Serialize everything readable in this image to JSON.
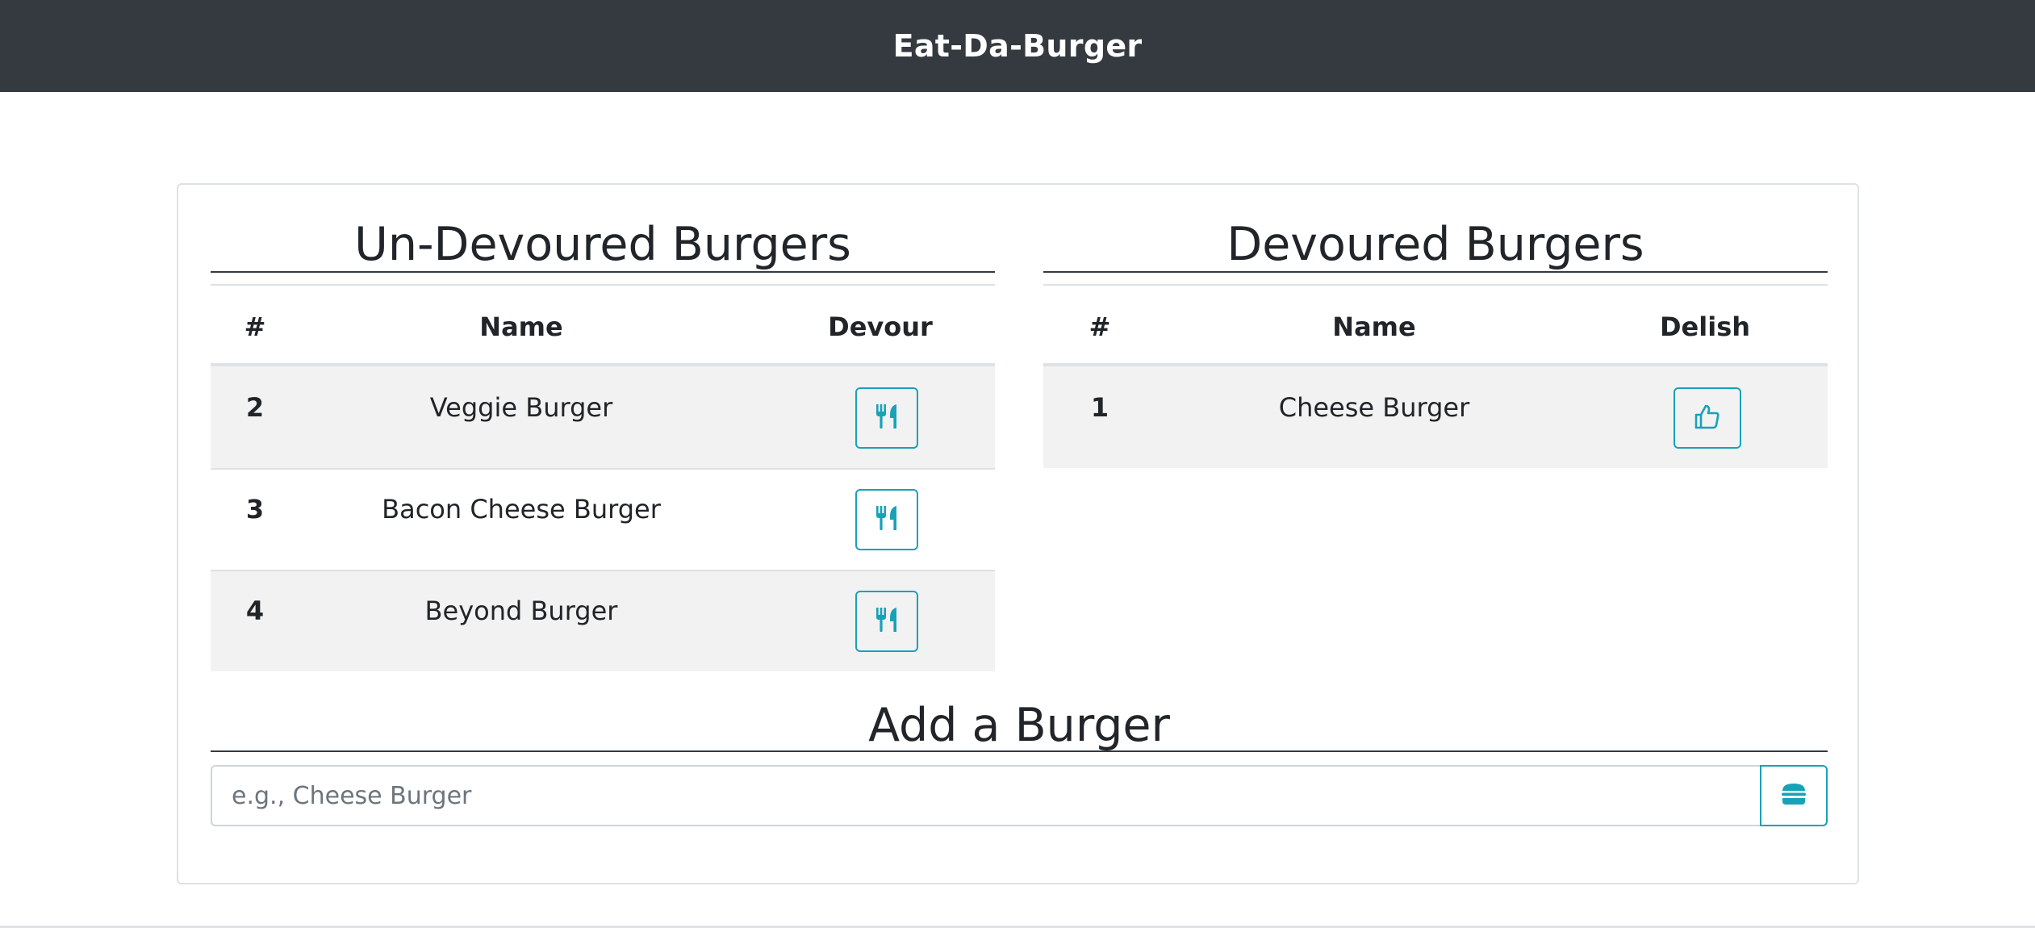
{
  "navbar": {
    "brand": "Eat-Da-Burger"
  },
  "undevoured": {
    "title": "Un-Devoured Burgers",
    "headers": {
      "num": "#",
      "name": "Name",
      "action": "Devour"
    },
    "rows": [
      {
        "id": "2",
        "name": "Veggie Burger",
        "action_icon": "utensils-icon"
      },
      {
        "id": "3",
        "name": "Bacon Cheese Burger",
        "action_icon": "utensils-icon"
      },
      {
        "id": "4",
        "name": "Beyond Burger",
        "action_icon": "utensils-icon"
      }
    ]
  },
  "devoured": {
    "title": "Devoured Burgers",
    "headers": {
      "num": "#",
      "name": "Name",
      "action": "Delish"
    },
    "rows": [
      {
        "id": "1",
        "name": "Cheese Burger",
        "action_icon": "thumbs-up-icon"
      }
    ]
  },
  "add": {
    "title": "Add a Burger",
    "placeholder": "e.g., Cheese Burger",
    "value": "",
    "button_icon": "hamburger-icon"
  },
  "colors": {
    "navbar": "#343a40",
    "accent": "#17a2b8",
    "stripe": "#f2f2f2"
  }
}
